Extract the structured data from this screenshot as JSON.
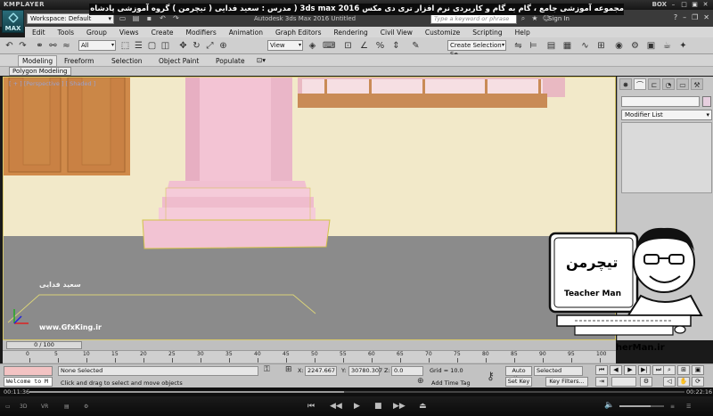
{
  "kmplayer": {
    "title": "KMPLAYER",
    "right_label": "BOX",
    "time_elapsed": "00:11:36",
    "time_total": "00:22:16",
    "progress": 0.48,
    "volume": 0.7
  },
  "banner_text": "مجموعه آموزشی جامع ، گام به گام و کاربردی نرم افزار تری دی مکس 3ds max 2016 ( مدرس : سعید فدایی ( تیچرمن ) گروه آموزشی پادشاه گرافیست ها",
  "max": {
    "logo": "MAX",
    "workspace": "Workspace: Default",
    "app_title": "Autodesk 3ds Max 2016    Untitled",
    "search_placeholder": "Type a keyword or phrase",
    "signin": "Sign In",
    "menu": [
      "Edit",
      "Tools",
      "Group",
      "Views",
      "Create",
      "Modifiers",
      "Animation",
      "Graph Editors",
      "Rendering",
      "Civil View",
      "Customize",
      "Scripting",
      "Help"
    ],
    "toolbar": {
      "filter": "All",
      "refcoord": "View",
      "selection_set": "Create Selection Se"
    },
    "ribbon_tabs": [
      "Modeling",
      "Freeform",
      "Selection",
      "Object Paint",
      "Populate"
    ],
    "ribbon_subtab": "Polygon Modeling",
    "viewport_label": "[ + ] [Perspective ] [ Shaded ]",
    "modifier_list": "Modifier List",
    "watermark_name": "سعید فدایی",
    "watermark_url": "www.GfxKing.ir",
    "teacherman_url": "www.TeacherMan.ir",
    "timeline": {
      "frame": "0 / 100",
      "ticks": [
        "0",
        "5",
        "10",
        "15",
        "20",
        "25",
        "30",
        "35",
        "40",
        "45",
        "50",
        "55",
        "60",
        "65",
        "70",
        "75",
        "80",
        "85",
        "90",
        "95",
        "100"
      ]
    },
    "status": {
      "listener": "Welcome to M",
      "selection": "None Selected",
      "prompt": "Click and drag to select and move objects",
      "x_label": "X:",
      "x_value": "2247.667",
      "y_label": "Y:",
      "y_value": "30780.307",
      "z_label": "Z:",
      "z_value": "0.0",
      "grid": "Grid = 10.0",
      "add_time_tag": "Add Time Tag",
      "auto_key": "Auto Key",
      "set_key": "Set Key",
      "selected": "Selected",
      "key_filters": "Key Filters..."
    }
  }
}
